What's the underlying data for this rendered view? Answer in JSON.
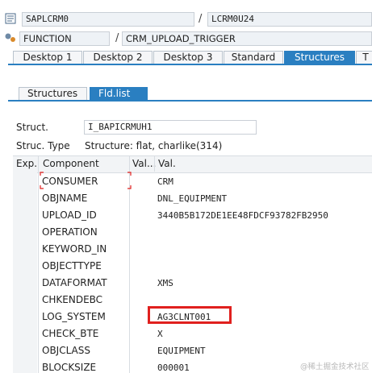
{
  "program": {
    "main_program": "SAPLCRM0",
    "include": "LCRM0U24",
    "object_type": "FUNCTION",
    "object_name": "CRM_UPLOAD_TRIGGER"
  },
  "tabs": [
    "Desktop 1",
    "Desktop 2",
    "Desktop 3",
    "Standard",
    "Structures",
    "T"
  ],
  "subtabs": [
    "Structures",
    "Fld.list"
  ],
  "struct": {
    "struct_label": "Struct.",
    "struct_value": "I_BAPICRMUH1",
    "type_label": "Struc. Type",
    "type_value": "Structure: flat, charlike(314)"
  },
  "table": {
    "headers": [
      "Exp.",
      "Component",
      "Val...",
      "Val."
    ],
    "rows": [
      {
        "component": "CONSUMER",
        "value": "CRM"
      },
      {
        "component": "OBJNAME",
        "value": "DNL_EQUIPMENT"
      },
      {
        "component": "UPLOAD_ID",
        "value": "3440B5B172DE1EE48FDCF93782FB2950"
      },
      {
        "component": "OPERATION",
        "value": ""
      },
      {
        "component": "KEYWORD_IN",
        "value": ""
      },
      {
        "component": "OBJECTTYPE",
        "value": ""
      },
      {
        "component": "DATAFORMAT",
        "value": "XMS"
      },
      {
        "component": "CHKENDEBC",
        "value": ""
      },
      {
        "component": "LOG_SYSTEM",
        "value": "AG3CLNT001"
      },
      {
        "component": "CHECK_BTE",
        "value": "X"
      },
      {
        "component": "OBJCLASS",
        "value": "EQUIPMENT"
      },
      {
        "component": "BLOCKSIZE",
        "value": "000001"
      }
    ]
  },
  "colors": {
    "accent": "#2a7fc1",
    "highlight": "#e0201e"
  },
  "watermark": "@稀土掘金技术社区"
}
